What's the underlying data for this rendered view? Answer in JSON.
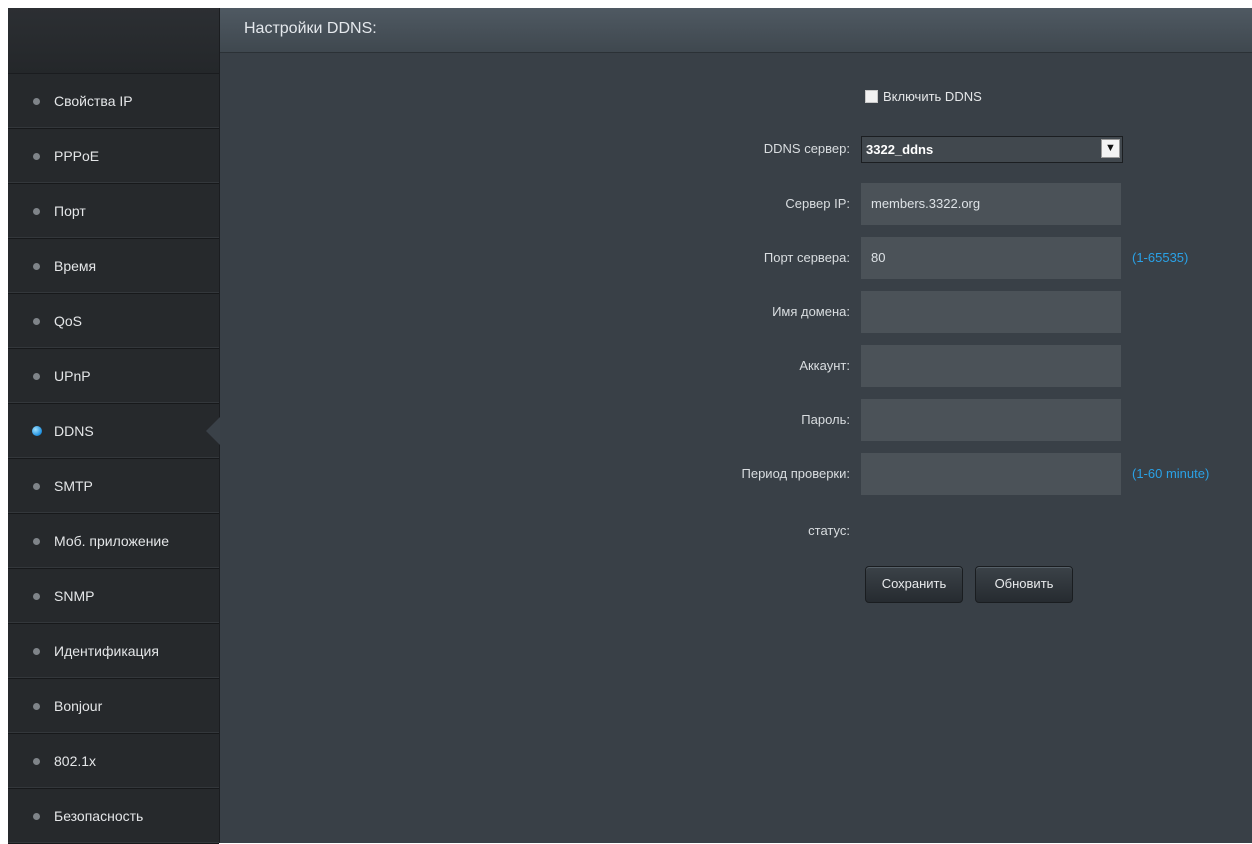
{
  "sidebar": {
    "items": [
      {
        "label": "Свойства IP"
      },
      {
        "label": "PPPoE"
      },
      {
        "label": "Порт"
      },
      {
        "label": "Время"
      },
      {
        "label": "QoS"
      },
      {
        "label": "UPnP"
      },
      {
        "label": "DDNS",
        "active": true
      },
      {
        "label": "SMTP"
      },
      {
        "label": "Моб. приложение"
      },
      {
        "label": "SNMP"
      },
      {
        "label": "Идентификация"
      },
      {
        "label": "Bonjour"
      },
      {
        "label": "802.1x"
      },
      {
        "label": "Безопасность"
      }
    ]
  },
  "main": {
    "title": "Настройки DDNS:",
    "enable_label": "Включить DDNS",
    "enable_checked": false,
    "server": {
      "label": "DDNS сервер:",
      "value": "3322_ddns"
    },
    "server_ip": {
      "label": "Сервер IP:",
      "value": "members.3322.org"
    },
    "server_port": {
      "label": "Порт сервера:",
      "value": "80",
      "hint": "(1-65535)"
    },
    "domain": {
      "label": "Имя домена:",
      "value": ""
    },
    "account": {
      "label": "Аккаунт:",
      "value": ""
    },
    "password": {
      "label": "Пароль:",
      "value": ""
    },
    "period": {
      "label": "Период проверки:",
      "value": "",
      "hint": "(1-60 minute)"
    },
    "status": {
      "label": "статус:",
      "value": ""
    },
    "save_label": "Сохранить",
    "refresh_label": "Обновить"
  },
  "colors": {
    "accent": "#2aa1e6",
    "sidebar_bg": "#26292c",
    "main_bg": "#394047",
    "field_bg": "#4b5258"
  }
}
